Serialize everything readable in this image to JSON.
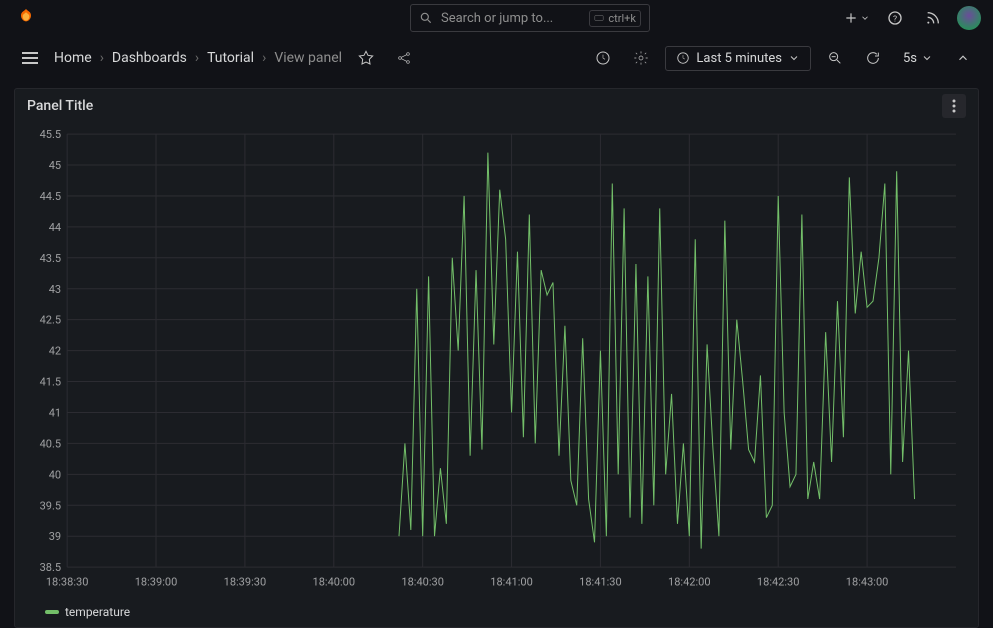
{
  "header": {
    "search_placeholder": "Search or jump to...",
    "keyboard_shortcut": "ctrl+k"
  },
  "breadcrumb": {
    "home": "Home",
    "dashboards": "Dashboards",
    "tutorial": "Tutorial",
    "view_panel": "View panel"
  },
  "toolbar": {
    "time_range": "Last 5 minutes",
    "refresh_interval": "5s"
  },
  "panel": {
    "title": "Panel Title",
    "legend_series": "temperature"
  },
  "chart_data": {
    "type": "line",
    "title": "Panel Title",
    "series": [
      {
        "name": "temperature",
        "color": "#73BF69"
      }
    ],
    "x_ticks": [
      "18:38:30",
      "18:39:00",
      "18:39:30",
      "18:40:00",
      "18:40:30",
      "18:41:00",
      "18:41:30",
      "18:42:00",
      "18:42:30",
      "18:43:00"
    ],
    "y_ticks": [
      "45.5",
      "45",
      "44.5",
      "44",
      "43.5",
      "43",
      "42.5",
      "42",
      "41.5",
      "41",
      "40.5",
      "40",
      "39.5",
      "39",
      "38.5"
    ],
    "ylim": [
      38.5,
      45.5
    ],
    "xlim_seconds": [
      0,
      300
    ],
    "x_labels": "time HH:MM:SS",
    "y_label": "",
    "data": {
      "x_seconds": [
        112,
        114,
        116,
        118,
        120,
        122,
        124,
        126,
        128,
        130,
        132,
        134,
        136,
        138,
        140,
        142,
        144,
        146,
        148,
        150,
        152,
        154,
        156,
        158,
        160,
        162,
        164,
        166,
        168,
        170,
        172,
        174,
        176,
        178,
        180,
        182,
        184,
        186,
        188,
        190,
        192,
        194,
        196,
        198,
        200,
        202,
        204,
        206,
        208,
        210,
        212,
        214,
        216,
        218,
        220,
        222,
        224,
        226,
        228,
        230,
        232,
        234,
        236,
        238,
        240,
        242,
        244,
        246,
        248,
        250,
        252,
        254,
        256,
        258,
        260,
        262,
        264,
        266,
        268,
        270,
        272,
        274,
        276,
        278,
        280,
        282,
        284,
        286
      ],
      "y": [
        39.0,
        40.5,
        39.1,
        43.0,
        39.0,
        43.2,
        39.0,
        40.1,
        39.2,
        43.5,
        42.0,
        44.5,
        40.3,
        43.3,
        40.4,
        45.2,
        42.1,
        44.6,
        43.8,
        41.0,
        43.6,
        40.6,
        44.2,
        40.5,
        43.3,
        42.9,
        43.1,
        40.3,
        42.4,
        39.9,
        39.5,
        42.2,
        39.6,
        38.9,
        42.0,
        39.0,
        44.7,
        40.0,
        44.3,
        39.3,
        43.4,
        39.2,
        43.2,
        39.5,
        44.3,
        40.0,
        41.3,
        39.2,
        40.5,
        39.0,
        43.8,
        38.8,
        42.1,
        40.4,
        39.0,
        44.1,
        40.4,
        42.5,
        41.5,
        40.4,
        40.2,
        41.6,
        39.3,
        39.5,
        44.5,
        41.0,
        39.8,
        40.0,
        44.2,
        39.6,
        40.2,
        39.6,
        42.3,
        40.2,
        42.8,
        40.6,
        44.8,
        42.6,
        43.6,
        42.7,
        42.8,
        43.5,
        44.7,
        40.0,
        44.9,
        40.2,
        42.0,
        39.6
      ]
    }
  }
}
